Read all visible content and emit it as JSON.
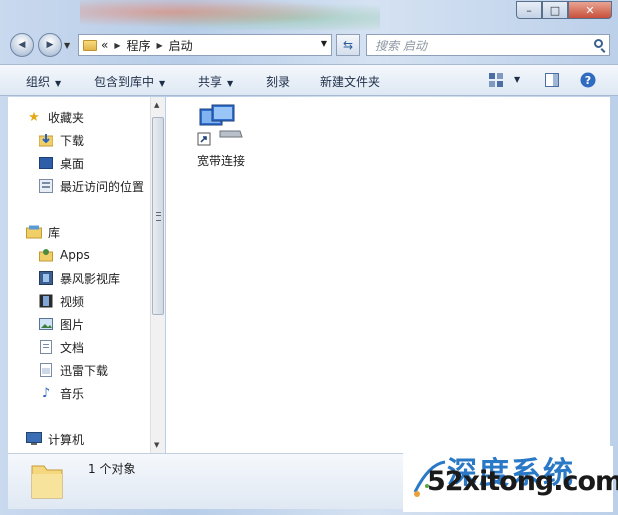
{
  "window": {
    "caption": {
      "minimize": "–",
      "maximize": "□",
      "close": "✕"
    }
  },
  "nav": {
    "back": "◀",
    "forward": "▶",
    "breadcrumb": [
      {
        "label": "«"
      },
      {
        "label": "程序"
      },
      {
        "label": "启动"
      }
    ],
    "search_placeholder": "搜索 启动"
  },
  "toolbar": {
    "organize": "组织",
    "include_in_library": "包含到库中",
    "share": "共享",
    "burn": "刻录",
    "new_folder": "新建文件夹"
  },
  "sidebar": {
    "favorites": {
      "label": "收藏夹",
      "items": [
        {
          "label": "下载",
          "icon": "download-folder-icon"
        },
        {
          "label": "桌面",
          "icon": "desktop-icon"
        },
        {
          "label": "最近访问的位置",
          "icon": "recent-places-icon"
        }
      ]
    },
    "libraries": {
      "label": "库",
      "items": [
        {
          "label": "Apps",
          "icon": "apps-library-icon"
        },
        {
          "label": "暴风影视库",
          "icon": "video-library-icon"
        },
        {
          "label": "视频",
          "icon": "film-icon"
        },
        {
          "label": "图片",
          "icon": "picture-icon"
        },
        {
          "label": "文档",
          "icon": "document-icon"
        },
        {
          "label": "迅雷下载",
          "icon": "thunder-download-icon"
        },
        {
          "label": "音乐",
          "icon": "music-icon"
        }
      ]
    },
    "computer": {
      "label": "计算机"
    }
  },
  "content": {
    "files": [
      {
        "label": "宽带连接",
        "icon": "network-connection-shortcut-icon"
      }
    ]
  },
  "status": {
    "count_text": "1 个对象"
  },
  "watermark": {
    "brand": "深度系统",
    "domain": "52xitong.com"
  }
}
